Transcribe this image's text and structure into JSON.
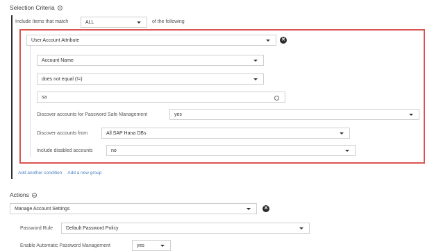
{
  "selection": {
    "title": "Selection Criteria",
    "include_label": "Include Items that match",
    "match_value": "ALL",
    "of_following": "of the following"
  },
  "condition": {
    "attribute": "User Account Attribute",
    "field": "Account Name",
    "operator": "does not equal (!=)",
    "value": "sa",
    "discover_pwd_label": "Discover accounts for Password Safe Management",
    "discover_pwd_value": "yes",
    "discover_from_label": "Discover accounts from",
    "discover_from_value": "All SAP Hana DBs",
    "include_disabled_label": "Include disabled accounts",
    "include_disabled_value": "no"
  },
  "links": {
    "add_condition": "Add another condition",
    "add_group": "Add a new group"
  },
  "actions": {
    "title": "Actions",
    "action": "Manage Account Settings",
    "password_rule_label": "Password Rule",
    "password_rule_value": "Default Password Policy",
    "auto_mgmt_label": "Enable Automatic Password Management",
    "auto_mgmt_value": "yes"
  },
  "colors": {
    "highlight": "#d9534f",
    "link": "#4a7fc1"
  }
}
